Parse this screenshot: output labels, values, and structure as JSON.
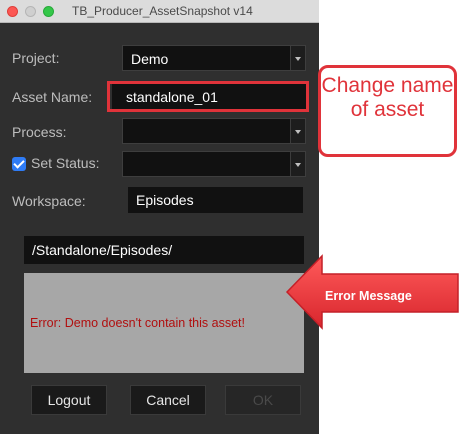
{
  "window": {
    "title": "TB_Producer_AssetSnapshot v14"
  },
  "form": {
    "project_label": "Project:",
    "project_value": "Demo",
    "asset_name_label": "Asset Name:",
    "asset_name_value": "standalone_01",
    "process_label": "Process:",
    "process_value": "",
    "set_status_label": "Set Status:",
    "set_status_checked": true,
    "set_status_value": "",
    "workspace_label": "Workspace:",
    "workspace_value": "Episodes",
    "path_value": "/Standalone/Episodes/"
  },
  "error": {
    "message": "Error: Demo doesn't contain this asset!"
  },
  "buttons": {
    "logout": "Logout",
    "cancel": "Cancel",
    "ok": "OK"
  },
  "annotations": {
    "callout_text": "Change name of asset",
    "arrow_text": "Error Message",
    "color": "#e0333a"
  }
}
